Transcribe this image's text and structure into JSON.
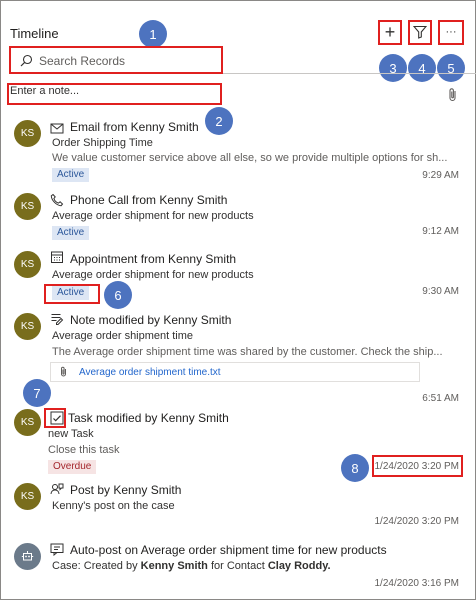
{
  "header": {
    "title": "Timeline",
    "search_placeholder": "Search Records",
    "note_placeholder": "Enter a note...",
    "add_glyph": "+",
    "more_glyph": "···"
  },
  "callouts": [
    "1",
    "2",
    "3",
    "4",
    "5",
    "6",
    "7",
    "8"
  ],
  "entries": [
    {
      "avatar": "KS",
      "icon": "email-icon",
      "title": "Email from Kenny Smith",
      "line1": "Order Shipping Time",
      "line2": "We value customer service above all else, so we provide multiple options for sh...",
      "badge": "Active",
      "time": "9:29 AM"
    },
    {
      "avatar": "KS",
      "icon": "phone-icon",
      "title": "Phone Call from Kenny Smith",
      "line1": "Average order shipment for new products",
      "badge": "Active",
      "time": "9:12 AM"
    },
    {
      "avatar": "KS",
      "icon": "calendar-icon",
      "title": "Appointment from Kenny Smith",
      "line1": "Average order shipment for new products",
      "badge": "Active",
      "time": "9:30 AM"
    },
    {
      "avatar": "KS",
      "icon": "note-icon",
      "title": "Note modified by Kenny Smith",
      "line1": "Average order shipment time",
      "line2": "The Average order shipment time was shared by the customer. Check the ship...",
      "attachment": "Average order shipment time.txt",
      "time": "6:51 AM"
    },
    {
      "avatar": "KS",
      "icon": "task-checkbox-icon",
      "title": "Task modified by Kenny Smith",
      "line1": "new Task",
      "line2": "Close this task",
      "badge": "Overdue",
      "time": "1/24/2020 3:20 PM"
    },
    {
      "avatar": "KS",
      "icon": "post-icon",
      "title": "Post by Kenny Smith",
      "line1": "Kenny's post on the case",
      "time": "1/24/2020 3:20 PM"
    },
    {
      "avatar": "",
      "icon": "auto-post-icon",
      "title": "Auto-post on Average order shipment time for new products",
      "line1_prefix": "Case: Created by ",
      "line1_bold1": "Kenny Smith",
      "line1_mid": " for Contact ",
      "line1_bold2": "Clay Roddy.",
      "time": "1/24/2020 3:16 PM"
    }
  ],
  "colors": {
    "callout": "#4d73bf",
    "highlight": "#e0201f",
    "avatar": "#796d1c",
    "active_badge_bg": "#dde6f4",
    "overdue_badge_bg": "#f6e4e4",
    "link": "#2266cc"
  }
}
